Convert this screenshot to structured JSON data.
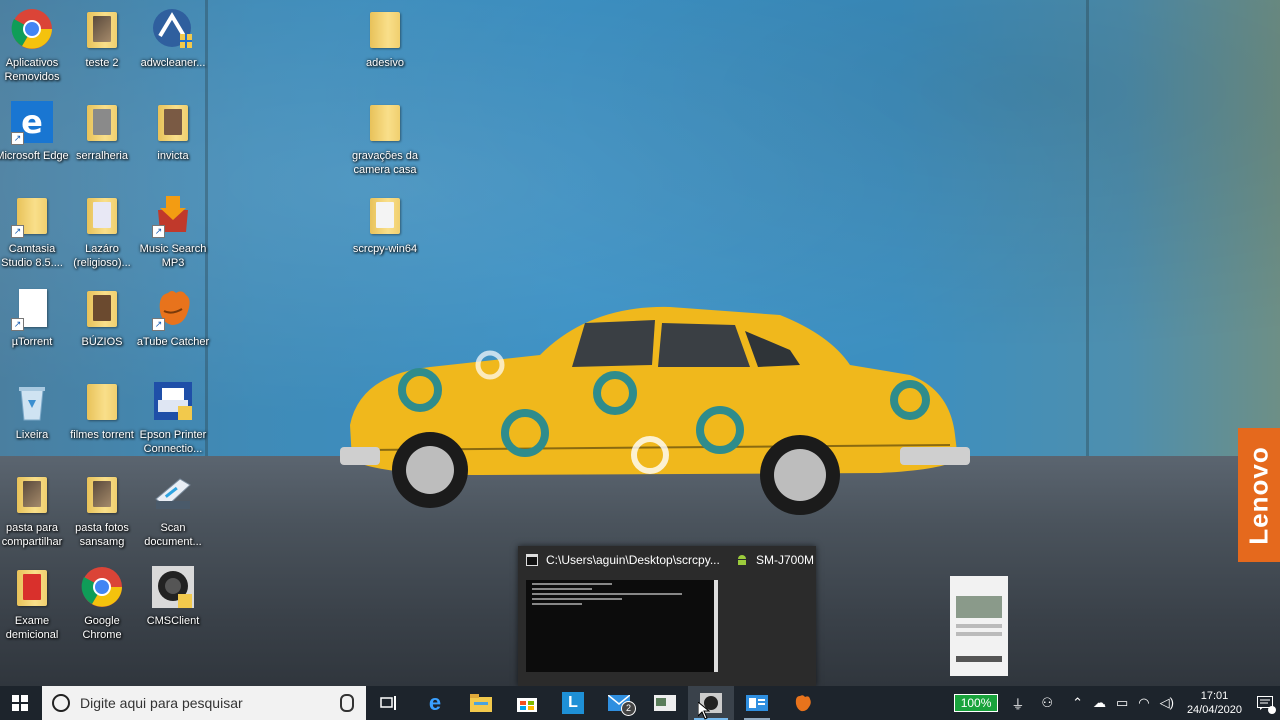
{
  "desktop": {
    "brand_text": "Lenovo",
    "icons": [
      {
        "label": "Aplicativos Removidos"
      },
      {
        "label": "teste 2"
      },
      {
        "label": "adwcleaner..."
      },
      {
        "label": "adesivo"
      },
      {
        "label": "Microsoft Edge"
      },
      {
        "label": "serralheria"
      },
      {
        "label": "invicta"
      },
      {
        "label": "gravações da camera casa"
      },
      {
        "label": "Camtasia Studio 8.5...."
      },
      {
        "label": "Lazáro (religioso)..."
      },
      {
        "label": "Music Search MP3"
      },
      {
        "label": "scrcpy-win64"
      },
      {
        "label": "µTorrent"
      },
      {
        "label": "BÚZIOS"
      },
      {
        "label": "aTube Catcher"
      },
      {
        "label": "Lixeira"
      },
      {
        "label": "filmes torrent"
      },
      {
        "label": "Epson Printer Connectio..."
      },
      {
        "label": "pasta para compartilhar"
      },
      {
        "label": "pasta fotos sansamg"
      },
      {
        "label": "Scan document..."
      },
      {
        "label": "Exame demicional"
      },
      {
        "label": "Google Chrome"
      },
      {
        "label": "CMSClient"
      }
    ]
  },
  "popup": {
    "window1_title": "C:\\Users\\aguin\\Desktop\\scrcpy...",
    "window2_title": "SM-J700M"
  },
  "taskbar": {
    "search_placeholder": "Digite aqui para pesquisar",
    "mail_badge": "2",
    "battery_percent": "100%",
    "time": "17:01",
    "date": "24/04/2020"
  },
  "colors": {
    "taskbar_bg": "#1d242c",
    "brand_orange": "#e5691d",
    "battery_green": "#19a33c",
    "accent_blue": "#76b9ed"
  }
}
